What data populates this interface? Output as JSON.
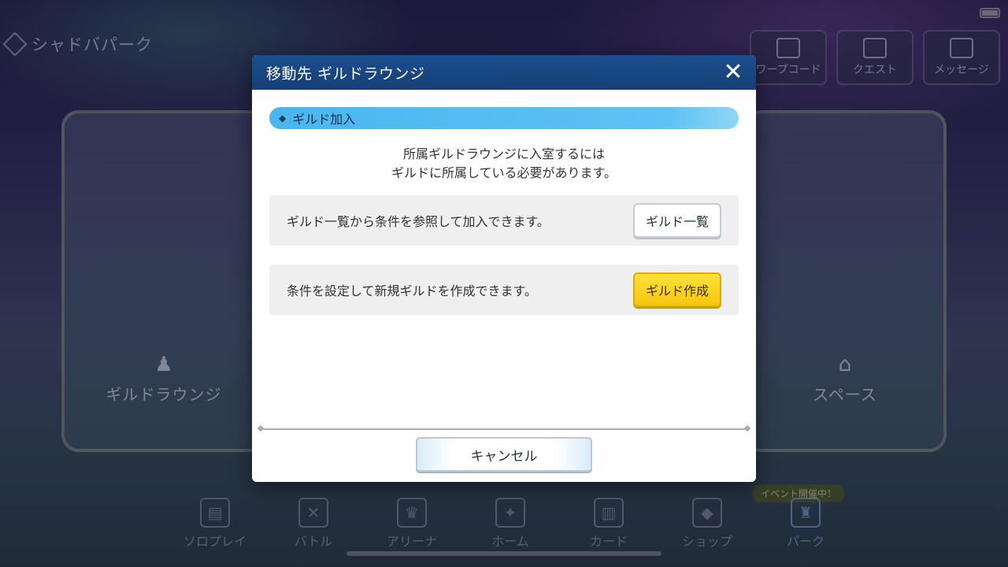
{
  "header": {
    "location_title": "シャドバパーク",
    "buttons": [
      {
        "label": "ワープコード",
        "icon": "warp-pin-icon"
      },
      {
        "label": "クエスト",
        "icon": "quest-icon"
      },
      {
        "label": "メッセージ",
        "icon": "message-icon"
      }
    ]
  },
  "areas": {
    "left_label": "ギルドラウンジ",
    "right_label": "スペース"
  },
  "bottom_nav": {
    "items": [
      {
        "label": "ソロプレイ",
        "icon": "solo-play-icon"
      },
      {
        "label": "バトル",
        "icon": "battle-icon"
      },
      {
        "label": "アリーナ",
        "icon": "arena-icon"
      },
      {
        "label": "ホーム",
        "icon": "home-icon"
      },
      {
        "label": "カード",
        "icon": "card-icon"
      },
      {
        "label": "ショップ",
        "icon": "shop-icon"
      },
      {
        "label": "パーク",
        "icon": "park-icon"
      }
    ],
    "event_badge": "イベント開催中！"
  },
  "modal": {
    "title": "移動先 ギルドラウンジ",
    "close_label": "✕",
    "section_label": "ギルド加入",
    "description_line1": "所属ギルドラウンジに入室するには",
    "description_line2": "ギルドに所属している必要があります。",
    "option1_text": "ギルド一覧から条件を参照して加入できます。",
    "option1_button": "ギルド一覧",
    "option2_text": "条件を設定して新規ギルドを作成できます。",
    "option2_button": "ギルド作成",
    "cancel_label": "キャンセル"
  },
  "colors": {
    "modal_header": "#1c4f8f",
    "section_bar": "#4ab6ee",
    "create_button": "#f6c60e"
  }
}
